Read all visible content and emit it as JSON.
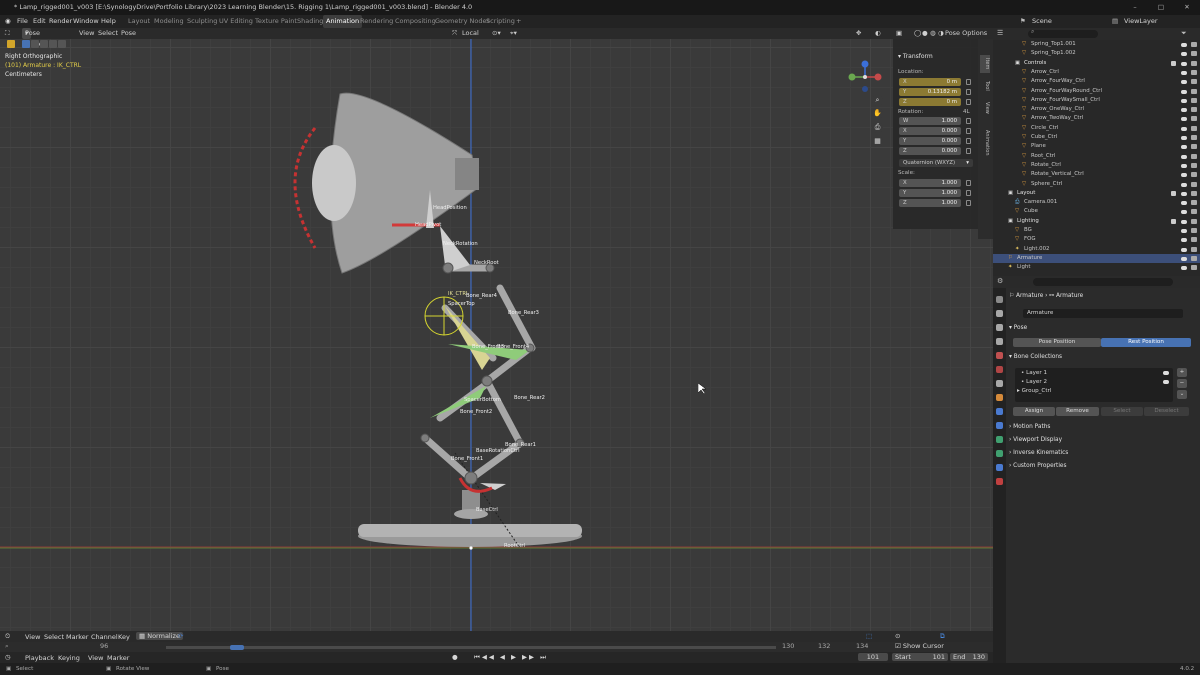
{
  "window": {
    "title": "* Lamp_rigged001_v003 [E:\\SynologyDrive\\Portfolio Library\\2023 Learning Blender\\15. Rigging 1\\Lamp_rigged001_v003.blend] - Blender 4.0"
  },
  "menu": [
    "File",
    "Edit",
    "Render",
    "Window",
    "Help"
  ],
  "workspaces": [
    "Layout",
    "Modeling",
    "Sculpting",
    "UV Editing",
    "Texture Paint",
    "Shading",
    "Animation",
    "Rendering",
    "Compositing",
    "Geometry Nodes",
    "Scripting"
  ],
  "active_workspace": "Animation",
  "scene": {
    "label": "Scene",
    "view_layer": "ViewLayer"
  },
  "viewport": {
    "mode": "Pose Mode",
    "menus": [
      "View",
      "Select",
      "Pose"
    ],
    "orientation": "Local",
    "pose_options": "Pose Options",
    "overlay_title": "Right Orthographic",
    "overlay_object": "(101) Armature : IK_CTRL",
    "overlay_units": "Centimeters",
    "bones": [
      "HeadPosition",
      "HeadPivot",
      "NeckRotation",
      "NeckRoot",
      "IK_CTRL",
      "Bone_Rear4",
      "SpacerTop",
      "Bone_Rear3",
      "Bone_Front3",
      "Bone_Front4",
      "Bone_Rear2",
      "SpacerBottom",
      "Bone_Front2",
      "Bone_Rear1",
      "BaseRotationCtrl",
      "Bone_Front1",
      "BaseCtrl",
      "RootCtrl"
    ]
  },
  "npanel": {
    "header": "Transform",
    "location_label": "Location:",
    "location": [
      {
        "axis": "X",
        "value": "0 m"
      },
      {
        "axis": "Y",
        "value": "0.13182 m"
      },
      {
        "axis": "Z",
        "value": "0 m"
      }
    ],
    "rotation_label": "Rotation:",
    "rotation_mode_short": "4L",
    "rotation": [
      {
        "axis": "W",
        "value": "1.000"
      },
      {
        "axis": "X",
        "value": "0.000"
      },
      {
        "axis": "Y",
        "value": "0.000"
      },
      {
        "axis": "Z",
        "value": "0.000"
      }
    ],
    "rotation_mode": "Quaternion (WXYZ)",
    "scale_label": "Scale:",
    "scale": [
      {
        "axis": "X",
        "value": "1.000"
      },
      {
        "axis": "Y",
        "value": "1.000"
      },
      {
        "axis": "Z",
        "value": "1.000"
      }
    ],
    "tabs": [
      "Item",
      "Tool",
      "View",
      "Animation"
    ]
  },
  "outliner": {
    "rows": [
      {
        "name": "Spring_Top1.001",
        "indent": 3,
        "type": "curve"
      },
      {
        "name": "Spring_Top1.002",
        "indent": 3,
        "type": "curve"
      },
      {
        "name": "Controls",
        "indent": 2,
        "type": "collection"
      },
      {
        "name": "Arrow_Ctrl",
        "indent": 3,
        "type": "obj"
      },
      {
        "name": "Arrow_FourWay_Ctrl",
        "indent": 3,
        "type": "obj"
      },
      {
        "name": "Arrow_FourWayRound_Ctrl",
        "indent": 3,
        "type": "obj"
      },
      {
        "name": "Arrow_FourWaySmall_Ctrl",
        "indent": 3,
        "type": "obj"
      },
      {
        "name": "Arrow_OneWay_Ctrl",
        "indent": 3,
        "type": "obj"
      },
      {
        "name": "Arrow_TwoWay_Ctrl",
        "indent": 3,
        "type": "obj"
      },
      {
        "name": "Circle_Ctrl",
        "indent": 3,
        "type": "obj"
      },
      {
        "name": "Cube_Ctrl",
        "indent": 3,
        "type": "obj"
      },
      {
        "name": "Plane",
        "indent": 3,
        "type": "obj"
      },
      {
        "name": "Root_Ctrl",
        "indent": 3,
        "type": "obj"
      },
      {
        "name": "Rotate_Ctrl",
        "indent": 3,
        "type": "obj"
      },
      {
        "name": "Rotate_Vertical_Ctrl",
        "indent": 3,
        "type": "obj"
      },
      {
        "name": "Sphere_Ctrl",
        "indent": 3,
        "type": "obj"
      },
      {
        "name": "Layout",
        "indent": 1,
        "type": "collection"
      },
      {
        "name": "Camera.001",
        "indent": 2,
        "type": "cam"
      },
      {
        "name": "Cube",
        "indent": 2,
        "type": "obj"
      },
      {
        "name": "Lighting",
        "indent": 1,
        "type": "collection"
      },
      {
        "name": "BG",
        "indent": 2,
        "type": "obj"
      },
      {
        "name": "FOG",
        "indent": 2,
        "type": "obj"
      },
      {
        "name": "Light.002",
        "indent": 2,
        "type": "light"
      },
      {
        "name": "Armature",
        "indent": 1,
        "type": "armature",
        "selected": true
      },
      {
        "name": "Light",
        "indent": 1,
        "type": "light"
      }
    ]
  },
  "properties": {
    "breadcrumb": [
      "Armature",
      "Armature"
    ],
    "datablock": "Armature",
    "pose_header": "Pose",
    "pose_position": "Pose Position",
    "rest_position": "Rest Position",
    "bone_collections_header": "Bone Collections",
    "collections": [
      "Layer 1",
      "Layer 2",
      "Group_Ctrl"
    ],
    "assign": "Assign",
    "remove": "Remove",
    "select": "Select",
    "deselect": "Deselect",
    "panels": [
      "Motion Paths",
      "Viewport Display",
      "Inverse Kinematics",
      "Custom Properties"
    ]
  },
  "timeline": {
    "menus": [
      "View",
      "Select",
      "Marker",
      "Channel",
      "Key"
    ],
    "normalize": "Normalize",
    "playback_menus": [
      "Playback",
      "Keying",
      "View",
      "Marker"
    ],
    "ruler": [
      "96",
      "130",
      "132",
      "134"
    ],
    "current_frame": "101",
    "start_label": "Start",
    "start": "101",
    "end_label": "End",
    "end": "130",
    "show_cursor": "Show Cursor"
  },
  "status": {
    "left": "Select",
    "middle": "Rotate View",
    "right": "Pose",
    "version": "4.0.2"
  },
  "colors": {
    "accent": "#4772b3",
    "selected_row": "#3c4f7a",
    "highlight_field": "#8c7a33",
    "axis_red": "#b03a3a",
    "axis_green": "#6aa84f",
    "axis_blue": "#3b6fd8"
  }
}
